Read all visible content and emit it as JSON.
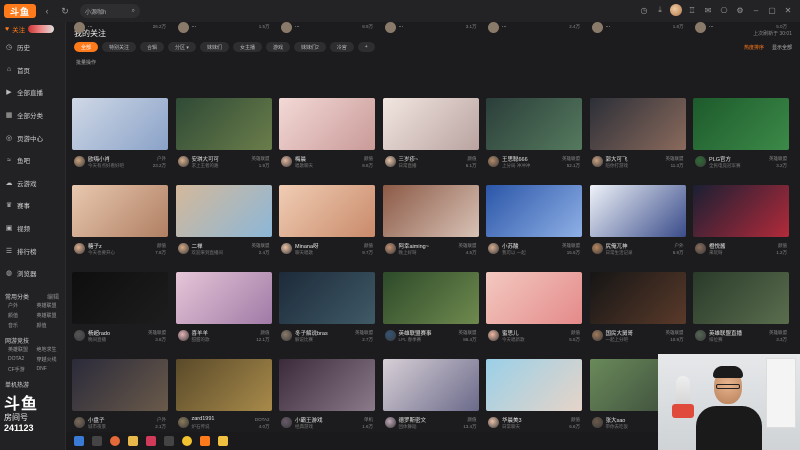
{
  "titlebar": {
    "logo": "斗鱼",
    "search_text": "小源咖h",
    "icons": [
      "refresh-icon",
      "back-icon",
      "search-icon",
      "history-icon",
      "download-icon",
      "avatar",
      "shirt-icon",
      "message-icon",
      "gift-icon",
      "settings-icon",
      "minimize-icon",
      "maximize-icon",
      "close-icon"
    ]
  },
  "sidebar": {
    "follow_label": "关注",
    "items": [
      {
        "label": "历史",
        "icon": "clock-icon"
      },
      {
        "label": "首页",
        "icon": "home-icon"
      },
      {
        "label": "全部直播",
        "icon": "play-icon"
      },
      {
        "label": "全部分类",
        "icon": "grid-icon"
      },
      {
        "label": "页游中心",
        "icon": "gamepad-icon"
      },
      {
        "label": "鱼吧",
        "icon": "fish-icon"
      },
      {
        "label": "云游戏",
        "icon": "cloud-icon"
      },
      {
        "label": "赛事",
        "icon": "trophy-icon"
      },
      {
        "label": "视频",
        "icon": "video-icon"
      },
      {
        "label": "排行榜",
        "icon": "rank-icon"
      },
      {
        "label": "浏览器",
        "icon": "browser-icon"
      }
    ],
    "section_common": "常用分类",
    "section_common_more": "编辑",
    "common_cats": [
      "户外",
      "英雄联盟",
      "颜值",
      "英雄联盟",
      "音乐",
      "颜值"
    ],
    "section_web": "网游竞技",
    "web_cats": [
      "英雄联盟",
      "绝地求生",
      "DOTA2",
      "穿越火线",
      "CF手游",
      "DNF"
    ],
    "section_single": "单机热游",
    "douyu_big": "斗鱼",
    "douyu_small": "房间号",
    "room_number": "241123"
  },
  "main": {
    "title": "我的关注",
    "updated": "上次刷新于 30:01",
    "filters": [
      {
        "label": "全部",
        "active": true
      },
      {
        "label": "特别关注",
        "active": false
      },
      {
        "label": "合辑",
        "active": false
      },
      {
        "label": "分区 ▾",
        "active": false
      },
      {
        "label": "妹妹们",
        "active": false
      },
      {
        "label": "女主播",
        "active": false
      },
      {
        "label": "游戏",
        "active": false
      },
      {
        "label": "妹妹们2",
        "active": false
      },
      {
        "label": "冷宫",
        "active": false
      },
      {
        "label": "+",
        "active": false
      }
    ],
    "right_actions": [
      "热度排序",
      "显示全部"
    ],
    "batch_label": "批量操作"
  },
  "cards": [
    {
      "name": "欧嗨小肖",
      "cat": "户外",
      "sub": "今天有点好看好吧",
      "heat": "23.2万",
      "thumb": "linear-gradient(135deg,#cfd8e6,#8aa2c8)",
      "av": "#c9a27e"
    },
    {
      "name": "安琪大可可",
      "cat": "英雄联盟",
      "sub": "求上王者的路",
      "heat": "1.9万",
      "thumb": "linear-gradient(135deg,#2f4a36,#6a7d4a)",
      "av": "#d9b08c"
    },
    {
      "name": "梅晨",
      "cat": "颜值",
      "sub": "唱歌聊天",
      "heat": "8.6万",
      "thumb": "linear-gradient(135deg,#f3d9d6,#c99a98)",
      "av": "#e2b6a0"
    },
    {
      "name": "三岁疹~",
      "cat": "颜值",
      "sub": "日常直播",
      "heat": "6.1万",
      "thumb": "linear-gradient(135deg,#f2e6e1,#b9a3a0)",
      "av": "#e8c3a8"
    },
    {
      "name": "王思聪666",
      "cat": "英雄联盟",
      "sub": "上分局 冲冲冲",
      "heat": "52.1万",
      "thumb": "linear-gradient(135deg,#2b3e3a,#557a5e)",
      "av": "#b48a6a"
    },
    {
      "name": "郭大可飞",
      "cat": "英雄联盟",
      "sub": "陪你打游戏",
      "heat": "11.3万",
      "thumb": "linear-gradient(135deg,#2c2f38,#8a6a5c)",
      "av": "#caa082"
    },
    {
      "name": "PLG官方",
      "cat": "英雄联盟",
      "sub": "全民电竞冠军赛",
      "heat": "3.2万",
      "thumb": "linear-gradient(135deg,#1d5a2c,#3c8a48)",
      "av": "#2d6b35"
    },
    {
      "name": "糖子z",
      "cat": "颜值",
      "sub": "今天也要开心",
      "heat": "7.8万",
      "thumb": "linear-gradient(135deg,#e8c8b0,#b07f62)",
      "av": "#e0b090"
    },
    {
      "name": "二禅",
      "cat": "英雄联盟",
      "sub": "欢迎来到直播间",
      "heat": "2.4万",
      "thumb": "linear-gradient(135deg,#d4b89a,#8cb7d8)",
      "av": "#d5a985"
    },
    {
      "name": "Minana呀",
      "cat": "颜值",
      "sub": "聊天唱歌",
      "heat": "9.7万",
      "thumb": "linear-gradient(135deg,#f0cdb4,#c98a6a)",
      "av": "#ecc2a6"
    },
    {
      "name": "阿幸aiming~",
      "cat": "英雄联盟",
      "sub": "晚上好呀",
      "heat": "4.5万",
      "thumb": "linear-gradient(135deg,#8c5a46,#d8c2b6)",
      "av": "#c39074"
    },
    {
      "name": "小苏酸",
      "cat": "英雄联盟",
      "sub": "我可以 一起",
      "heat": "15.6万",
      "thumb": "linear-gradient(135deg,#2b56a8,#8fb0e6)",
      "av": "#d5ac90"
    },
    {
      "name": "尻俺兀神",
      "cat": "户外",
      "sub": "日常生活记录",
      "heat": "6.9万",
      "thumb": "linear-gradient(135deg,#eef2f8,#3a4c8a)",
      "av": "#b9865f"
    },
    {
      "name": "橙悦酱",
      "cat": "颜值",
      "sub": "来玩呀",
      "heat": "1.2万",
      "thumb": "linear-gradient(135deg,#1a1f33,#b22a3a)",
      "av": "#8a6d5c"
    },
    {
      "name": "杨超rado",
      "cat": "英雄联盟",
      "sub": "晚间直播",
      "heat": "3.8万",
      "thumb": "linear-gradient(135deg,#0e0e0e,#1d1d1d)",
      "av": "#555"
    },
    {
      "name": "喜羊羊",
      "cat": "颜值",
      "sub": "甜甜的歌",
      "heat": "12.1万",
      "thumb": "linear-gradient(135deg,#e6c6d8,#a07aa6)",
      "av": "#e6b4b8"
    },
    {
      "name": "冬子解说bras",
      "cat": "英雄联盟",
      "sub": "解说比赛",
      "heat": "2.7万",
      "thumb": "linear-gradient(135deg,#1d2a3a,#3f5a66)",
      "av": "#8a7a6a"
    },
    {
      "name": "英雄联盟赛事",
      "cat": "英雄联盟",
      "sub": "LPL 春季赛",
      "heat": "86.4万",
      "thumb": "linear-gradient(135deg,#2d4a2a,#6f8a4e)",
      "av": "#335577"
    },
    {
      "name": "蜜思儿",
      "cat": "颜值",
      "sub": "今天唱新歌",
      "heat": "5.5万",
      "thumb": "linear-gradient(135deg,#f3c9c0,#e48a8a)",
      "av": "#f0b8a4"
    },
    {
      "name": "国民大舅哥",
      "cat": "英雄联盟",
      "sub": "一起上分吧",
      "heat": "10.9万",
      "thumb": "linear-gradient(135deg,#151515,#5a3a2a)",
      "av": "#a07a5a"
    },
    {
      "name": "英雄联盟直播",
      "cat": "英雄联盟",
      "sub": "排位赛",
      "heat": "3.3万",
      "thumb": "linear-gradient(135deg,#2a3a2a,#5a6e4e)",
      "av": "#556655"
    },
    {
      "name": "小盘子",
      "cat": "户外",
      "sub": "城市夜景",
      "heat": "2.1万",
      "thumb": "linear-gradient(135deg,#2a2a3a,#6a5a4a)",
      "av": "#7a6a5a"
    },
    {
      "name": "zard1991",
      "cat": "DOTA2",
      "sub": "炉石传说",
      "heat": "4.0万",
      "thumb": "linear-gradient(135deg,#5a4a2a,#a88a4a)",
      "av": "#8a7a5a"
    },
    {
      "name": "小霸王游戏",
      "cat": "单机",
      "sub": "经典游戏",
      "heat": "1.6万",
      "thumb": "linear-gradient(135deg,#3a2a3a,#8a7a8a)",
      "av": "#6a5a6a"
    },
    {
      "name": "德罗斯密文",
      "cat": "颜值",
      "sub": "团体舞蹈",
      "heat": "13.4万",
      "thumb": "linear-gradient(135deg,#d8cfd6,#6a6a8a)",
      "av": "#c0a8b8"
    },
    {
      "name": "华晨美3",
      "cat": "颜值",
      "sub": "日常聊天",
      "heat": "6.6万",
      "thumb": "linear-gradient(135deg,#9ad0e8,#e6d4c8)",
      "av": "#e8c0a8"
    },
    {
      "name": "张大sao",
      "cat": "户外",
      "sub": "带你去吃饭",
      "heat": "7.2万",
      "thumb": "linear-gradient(135deg,#6a8a5a,#3a4a3a)",
      "av": "#6a5a4a"
    }
  ],
  "peek_row": [
    {
      "name": "...",
      "heat": "26.2万"
    },
    {
      "name": "...",
      "heat": "1.5万"
    },
    {
      "name": "...",
      "heat": "8.9万"
    },
    {
      "name": "...",
      "heat": "3.1万"
    },
    {
      "name": "...",
      "heat": "2.4万"
    },
    {
      "name": "...",
      "heat": "1.8万"
    },
    {
      "name": "...",
      "heat": "5.0万"
    }
  ],
  "colors": {
    "accent": "#ff7a1a",
    "bg": "#1c1c1e",
    "sidebar": "#222224"
  }
}
